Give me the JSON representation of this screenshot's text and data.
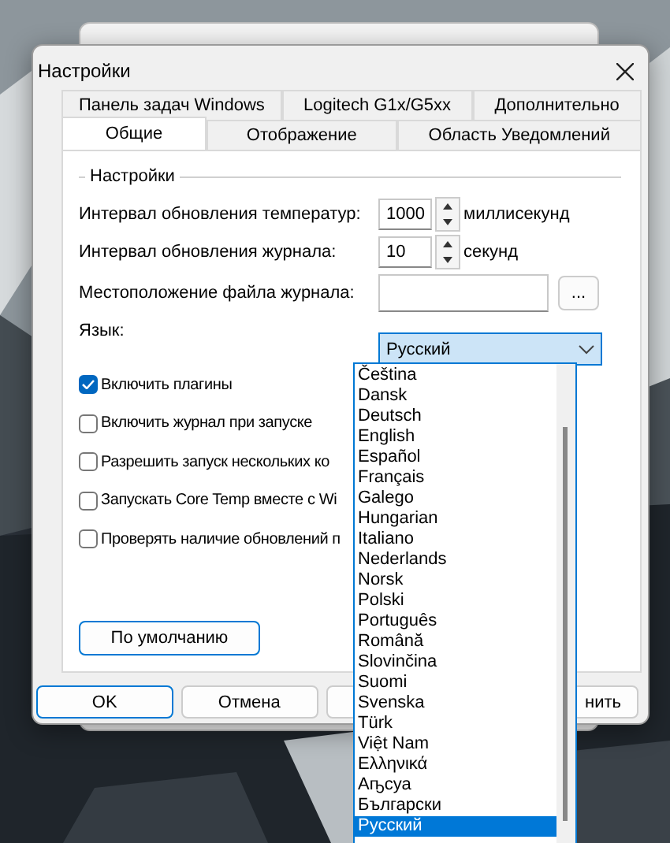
{
  "dialog": {
    "title": "Настройки",
    "tab_rows": [
      [
        {
          "label": "Панель задач Windows",
          "selected": false
        },
        {
          "label": "Logitech G1x/G5xx",
          "selected": false
        },
        {
          "label": "Дополнительно",
          "selected": false
        }
      ],
      [
        {
          "label": "Общие",
          "selected": true
        },
        {
          "label": "Отображение",
          "selected": false
        },
        {
          "label": "Область Уведомлений",
          "selected": false
        }
      ]
    ],
    "group_title": "Настройки",
    "temp_interval": {
      "label": "Интервал обновления температур:",
      "value": "1000",
      "unit": "миллисекунд"
    },
    "log_interval": {
      "label": "Интервал обновления журнала:",
      "value": "10",
      "unit": "секунд"
    },
    "log_location": {
      "label": "Местоположение файла журнала:",
      "browse": "..."
    },
    "language": {
      "label": "Язык:",
      "value": "Русский",
      "expanded": true,
      "options": [
        {
          "label": "Čeština",
          "selected": false
        },
        {
          "label": "Dansk",
          "selected": false
        },
        {
          "label": "Deutsch",
          "selected": false
        },
        {
          "label": "English",
          "selected": false
        },
        {
          "label": "Español",
          "selected": false
        },
        {
          "label": "Français",
          "selected": false
        },
        {
          "label": "Galego",
          "selected": false
        },
        {
          "label": "Hungarian",
          "selected": false
        },
        {
          "label": "Italiano",
          "selected": false
        },
        {
          "label": "Nederlands",
          "selected": false
        },
        {
          "label": "Norsk",
          "selected": false
        },
        {
          "label": "Polski",
          "selected": false
        },
        {
          "label": "Português",
          "selected": false
        },
        {
          "label": "Română",
          "selected": false
        },
        {
          "label": "Slovinčina",
          "selected": false
        },
        {
          "label": "Suomi",
          "selected": false
        },
        {
          "label": "Svenska",
          "selected": false
        },
        {
          "label": "Türk",
          "selected": false
        },
        {
          "label": "Việt Nam",
          "selected": false
        },
        {
          "label": "Ελληνικά",
          "selected": false
        },
        {
          "label": "Аҧсуа",
          "selected": false
        },
        {
          "label": "Български",
          "selected": false
        },
        {
          "label": "Русский",
          "selected": true
        }
      ]
    },
    "checkboxes": [
      {
        "label": "Включить плагины",
        "checked": true
      },
      {
        "label": "Включить журнал при запуске",
        "checked": false
      },
      {
        "label": "Разрешить запуск нескольких ко",
        "checked": false
      },
      {
        "label": "Запускать Core Temp вместе с Wi",
        "checked": false
      },
      {
        "label": "Проверять наличие обновлений п",
        "checked": false
      }
    ],
    "default_button": "По умолчанию",
    "buttons": [
      {
        "label": "OK",
        "primary": true
      },
      {
        "label": "Отмена",
        "primary": false
      },
      {
        "primary": false
      },
      {
        "label": "нить",
        "primary": false
      }
    ]
  }
}
